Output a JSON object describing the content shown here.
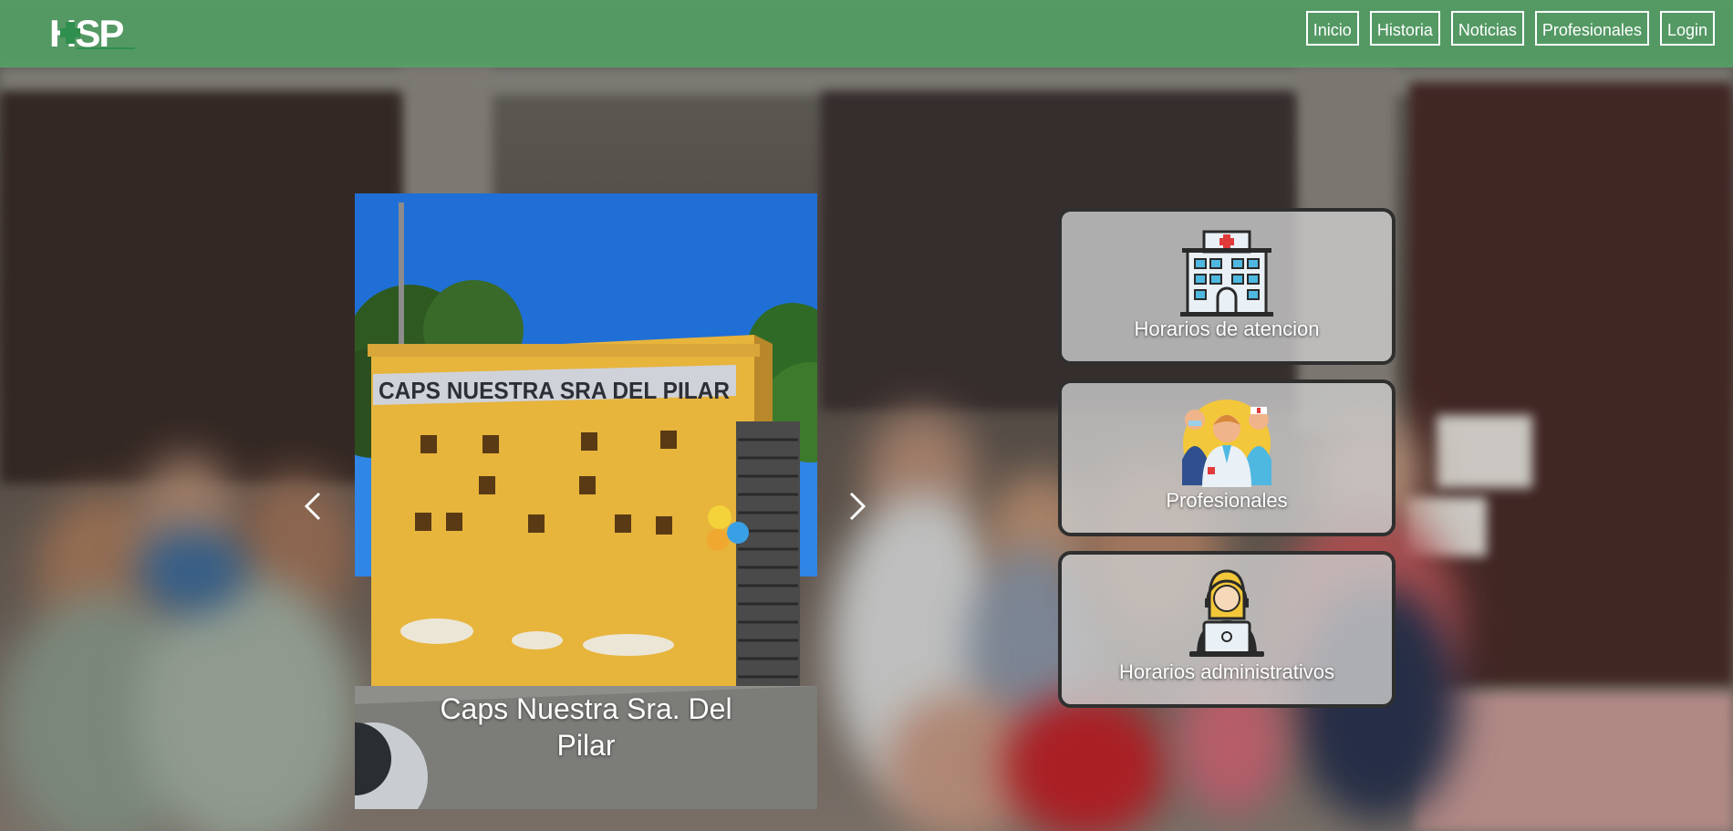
{
  "brand": {
    "logo_text": "HSP",
    "color": "#2f8f4e"
  },
  "nav": {
    "items": [
      {
        "label": "Inicio"
      },
      {
        "label": "Historia"
      },
      {
        "label": "Noticias"
      },
      {
        "label": "Profesionales"
      },
      {
        "label": "Login"
      }
    ]
  },
  "carousel": {
    "caption": "Caps Nuestra Sra. Del Pilar",
    "sign_text": "CAPS NUESTRA SRA DEL PILAR",
    "prev_icon": "chevron-left-icon",
    "next_icon": "chevron-right-icon"
  },
  "cards": [
    {
      "label": "Horarios de atencion",
      "icon": "hospital-icon"
    },
    {
      "label": "Profesionales",
      "icon": "medical-staff-icon"
    },
    {
      "label": "Horarios administrativos",
      "icon": "receptionist-laptop-icon"
    }
  ],
  "colors": {
    "navbar": "#52aa68",
    "card_bg": "#cacaca",
    "card_border": "#2f2f2f"
  }
}
